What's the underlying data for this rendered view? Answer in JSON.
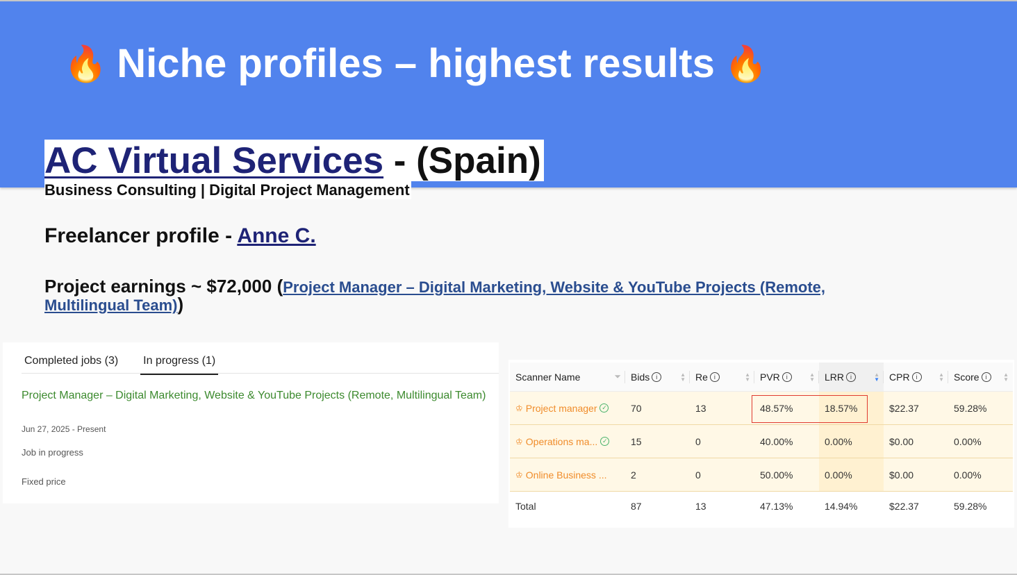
{
  "slide": {
    "title": "Niche profiles – highest results",
    "title_flame_left": "🔥",
    "title_flame_right": "🔥",
    "banner_color": "#5183ed"
  },
  "company": {
    "name": "AC Virtual Services",
    "suffix": " - (Spain)",
    "subtitle": "Business Consulting | Digital Project Management"
  },
  "freelancer": {
    "prefix": "Freelancer profile - ",
    "name": "Anne C."
  },
  "earnings": {
    "prefix": "Project earnings ~ $72,000 (",
    "job_link": "Project Manager – Digital Marketing, Website & YouTube Projects (Remote, Multilingual Team)",
    "suffix": ")"
  },
  "jobs_panel": {
    "tabs": [
      {
        "label": "Completed jobs (3)",
        "active": false
      },
      {
        "label": "In progress (1)",
        "active": true
      }
    ],
    "job": {
      "title": "Project Manager – Digital Marketing, Website & YouTube Projects (Remote, Multilingual Team)",
      "date": "Jun 27, 2025 - Present",
      "status": "Job in progress",
      "type": "Fixed price"
    }
  },
  "scanner_table": {
    "columns": [
      {
        "label": "Scanner Name",
        "icon": "filter-icon"
      },
      {
        "label": "Bids",
        "icon": "info-icon"
      },
      {
        "label": "Re",
        "icon": "info-icon"
      },
      {
        "label": "PVR",
        "icon": "info-icon"
      },
      {
        "label": "LRR",
        "icon": "info-icon",
        "sorted": "descending"
      },
      {
        "label": "CPR",
        "icon": "info-icon"
      },
      {
        "label": "Score",
        "icon": "info-icon"
      }
    ],
    "rows": [
      {
        "name": "Project manager",
        "verified": true,
        "bids": "70",
        "re": "13",
        "pvr": "48.57%",
        "lrr": "18.57%",
        "cpr": "$22.37",
        "score": "59.28%"
      },
      {
        "name": "Operations ma...",
        "verified": true,
        "bids": "15",
        "re": "0",
        "pvr": "40.00%",
        "lrr": "0.00%",
        "cpr": "$0.00",
        "score": "0.00%"
      },
      {
        "name": "Online Business ...",
        "verified": false,
        "bids": "2",
        "re": "0",
        "pvr": "50.00%",
        "lrr": "0.00%",
        "cpr": "$0.00",
        "score": "0.00%"
      }
    ],
    "total": {
      "label": "Total",
      "bids": "87",
      "re": "13",
      "pvr": "47.13%",
      "lrr": "14.94%",
      "cpr": "$22.37",
      "score": "59.28%"
    },
    "highlight_color": "#e03a2f",
    "row_name_color": "#f08c2a"
  }
}
